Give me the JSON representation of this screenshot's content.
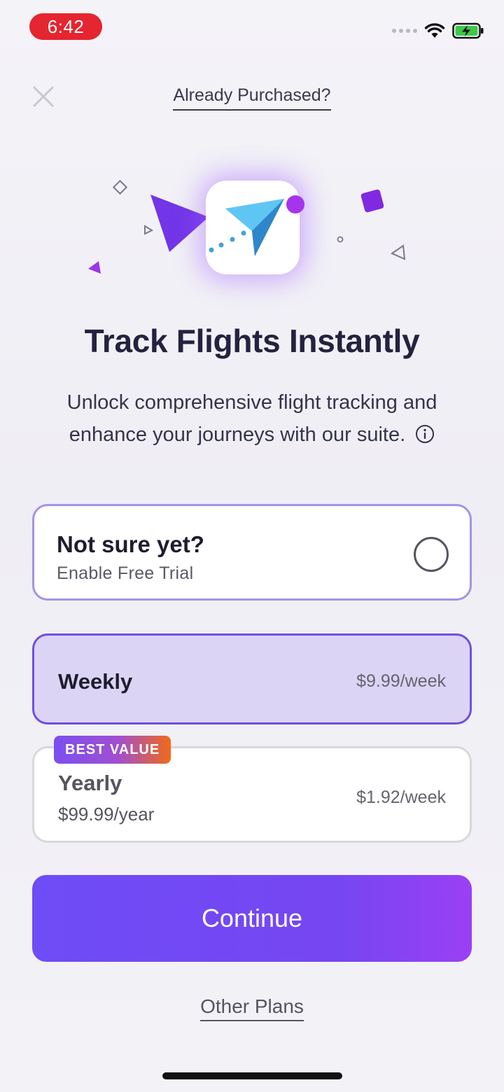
{
  "status_bar": {
    "time": "6:42",
    "icons": [
      "cellular-dots-icon",
      "wifi-icon",
      "battery-charging-icon"
    ]
  },
  "header": {
    "close_icon": "close-icon",
    "already_purchased": "Already Purchased?"
  },
  "hero": {
    "title": "Track Flights Instantly",
    "subtitle": "Unlock comprehensive flight tracking and enhance your journeys with our suite.",
    "info_icon": "info-icon"
  },
  "plans": {
    "trial": {
      "title": "Not sure yet?",
      "subtitle": "Enable Free Trial",
      "selected": false
    },
    "weekly": {
      "title": "Weekly",
      "price": "$9.99/week",
      "selected": true
    },
    "yearly": {
      "badge": "BEST VALUE",
      "title": "Yearly",
      "subtitle": "$99.99/year",
      "price": "$1.92/week",
      "selected": false
    }
  },
  "actions": {
    "continue_label": "Continue",
    "other_plans_label": "Other Plans"
  },
  "colors": {
    "accent": "#6e4cf6",
    "accent_end": "#9b3ff4",
    "selected_card_bg": "#dcd4f4",
    "time_pill": "#e5252f",
    "badge_orange": "#f06a18"
  }
}
